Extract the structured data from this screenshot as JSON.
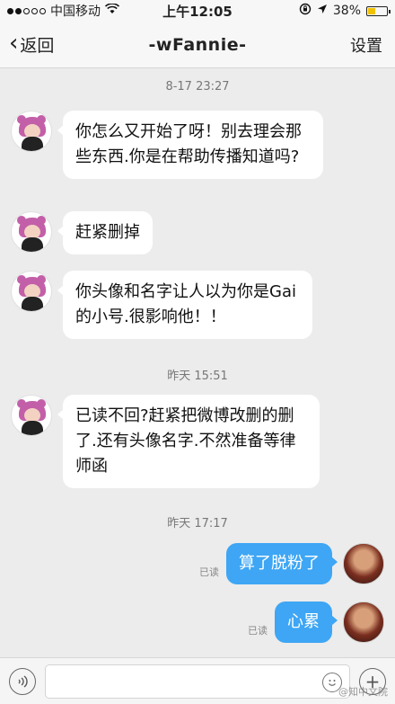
{
  "status_bar": {
    "carrier": "中国移动",
    "time": "上午12:05",
    "battery": "38%",
    "battery_level": 0.38
  },
  "nav": {
    "back_label": "返回",
    "title": "-wFannie-",
    "settings_label": "设置"
  },
  "messages": {
    "ts1": "8-17 23:27",
    "m1": "你怎么又开始了呀！别去理会那些东西.你是在帮助传播知道吗?",
    "m2": "赶紧删掉",
    "m3": "你头像和名字让人以为你是Gai的小号.很影响他！！",
    "ts2": "昨天 15:51",
    "m4": "已读不回?赶紧把微博改删的删了.还有头像名字.不然准备等律师函",
    "ts3": "昨天 17:17",
    "m5": "算了脱粉了",
    "m6": "心累",
    "read_label": "已读"
  },
  "input": {
    "placeholder": ""
  },
  "watermark": "@知中文院",
  "colors": {
    "accent": "#3ea6f4",
    "background": "#ececec",
    "battery": "#f2c200"
  }
}
